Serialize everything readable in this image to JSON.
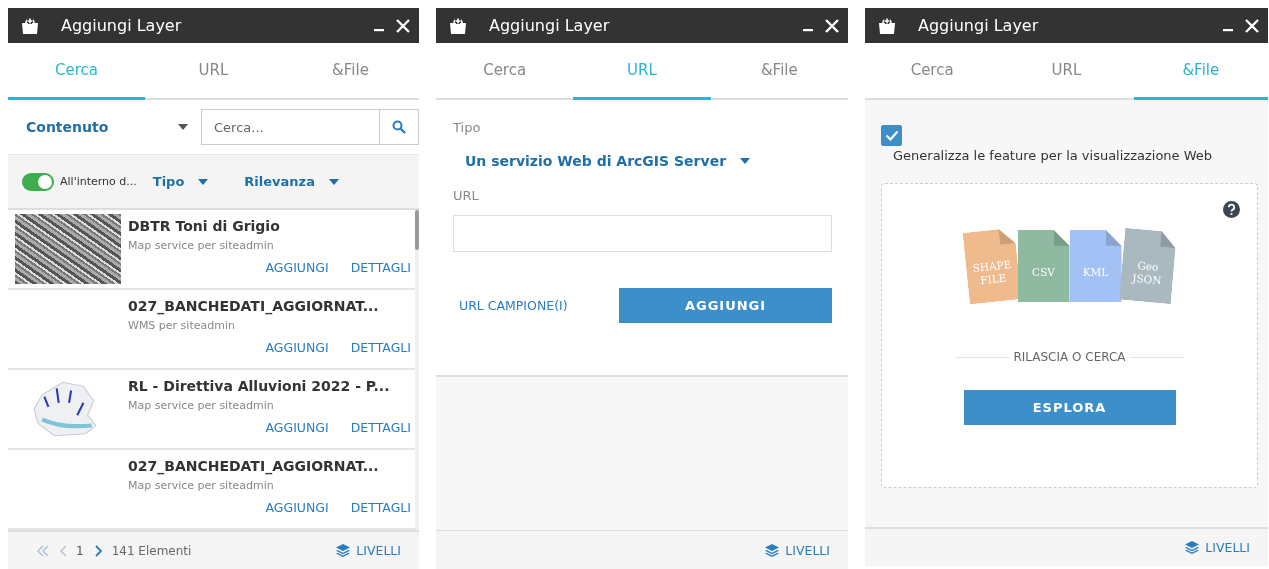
{
  "panels": [
    {
      "kind": "search",
      "title": "Aggiungi Layer",
      "tabs": [
        {
          "label": "Cerca",
          "selected": true
        },
        {
          "label": "URL",
          "selected": false
        },
        {
          "label": "&File",
          "selected": false
        }
      ],
      "content_dropdown": "Contenuto",
      "search": {
        "placeholder": "Cerca..."
      },
      "filters": {
        "toggle": {
          "label": "All'interno d...",
          "on": true
        },
        "type_dropdown": "Tipo",
        "sort_dropdown": "Rilevanza"
      },
      "results": [
        {
          "title": "DBTR Toni di Grigio",
          "subtitle": "Map service per siteadmin",
          "kind": "photo",
          "actions": [
            "AGGIUNGI",
            "DETTAGLI"
          ]
        },
        {
          "title": "027_BANCHEDATI_AGGIORNAT...",
          "subtitle": "WMS per siteadmin",
          "kind": "plain",
          "actions": [
            "AGGIUNGI",
            "DETTAGLI"
          ]
        },
        {
          "title": "RL - Direttiva Alluvioni 2022 - P...",
          "subtitle": "Map service per siteadmin",
          "kind": "map",
          "actions": [
            "AGGIUNGI",
            "DETTAGLI"
          ]
        },
        {
          "title": "027_BANCHEDATI_AGGIORNAT...",
          "subtitle": "Map service per siteadmin",
          "kind": "plain",
          "actions": [
            "AGGIUNGI",
            "DETTAGLI"
          ]
        }
      ],
      "pagination": {
        "first_disabled": true,
        "prev_disabled": true,
        "page": "1",
        "next_disabled": false,
        "count": "141 Elementi"
      },
      "footer_link": "LIVELLI"
    },
    {
      "kind": "url",
      "title": "Aggiungi Layer",
      "tabs": [
        {
          "label": "Cerca",
          "selected": false
        },
        {
          "label": "URL",
          "selected": true
        },
        {
          "label": "&File",
          "selected": false
        }
      ],
      "type_label": "Tipo",
      "type_value": "Un servizio Web di ArcGIS Server",
      "url_label": "URL",
      "sample_link": "URL CAMPIONE(I)",
      "add_button": "AGGIUNGI",
      "footer_link": "LIVELLI"
    },
    {
      "kind": "file",
      "title": "Aggiungi Layer",
      "tabs": [
        {
          "label": "Cerca",
          "selected": false
        },
        {
          "label": "URL",
          "selected": false
        },
        {
          "label": "&File",
          "selected": true
        }
      ],
      "generalize": {
        "label": "Generalizza le feature per la visualizzazione Web",
        "checked": true
      },
      "file_types": [
        {
          "label": "SHAPE FILE",
          "color": "#f0bb8c"
        },
        {
          "label": "CSV",
          "color": "#8fb9a0"
        },
        {
          "label": "KML",
          "color": "#a3c1f5"
        },
        {
          "label": "Geo JSON",
          "color": "#aab8c0"
        }
      ],
      "drop_label": "RILASCIA O CERCA",
      "browse_button": "ESPLORA",
      "footer_link": "LIVELLI"
    }
  ]
}
